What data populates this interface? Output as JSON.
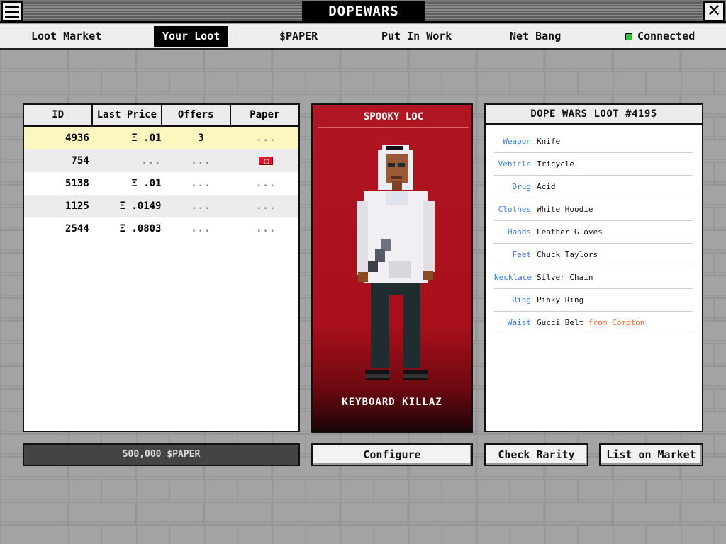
{
  "app": {
    "title": "DOPEWARS"
  },
  "nav": {
    "items": [
      {
        "label": "Loot Market"
      },
      {
        "label": "Your Loot"
      },
      {
        "label": "$PAPER"
      },
      {
        "label": "Put In Work"
      },
      {
        "label": "Net Bang"
      }
    ],
    "active": "Your Loot",
    "status_label": "Connected",
    "status_color": "#2bbf3a"
  },
  "table": {
    "columns": [
      "ID",
      "Last Price",
      "Offers",
      "Paper"
    ],
    "rows": [
      {
        "id": "4936",
        "price": "Ξ .01",
        "offers": "3",
        "paper": "..."
      },
      {
        "id": "754",
        "price": "...",
        "offers": "...",
        "paper": "paper-icon"
      },
      {
        "id": "5138",
        "price": "Ξ .01",
        "offers": "...",
        "paper": "..."
      },
      {
        "id": "1125",
        "price": "Ξ .0149",
        "offers": "...",
        "paper": "..."
      },
      {
        "id": "2544",
        "price": "Ξ .0803",
        "offers": "...",
        "paper": "..."
      }
    ]
  },
  "paper_balance": "500,000 $PAPER",
  "card": {
    "title": "SPOOKY LOC",
    "caption": "KEYBOARD KILLAZ",
    "background_color": "#b01622"
  },
  "details": {
    "title": "DOPE WARS LOOT #4195",
    "attributes": [
      {
        "key": "Weapon",
        "value": "Knife",
        "suffix": ""
      },
      {
        "key": "Vehicle",
        "value": "Tricycle",
        "suffix": ""
      },
      {
        "key": "Drug",
        "value": "Acid",
        "suffix": ""
      },
      {
        "key": "Clothes",
        "value": "White Hoodie",
        "suffix": ""
      },
      {
        "key": "Hands",
        "value": "Leather Gloves",
        "suffix": ""
      },
      {
        "key": "Feet",
        "value": "Chuck Taylors",
        "suffix": ""
      },
      {
        "key": "Necklace",
        "value": "Silver Chain",
        "suffix": ""
      },
      {
        "key": "Ring",
        "value": "Pinky Ring",
        "suffix": ""
      },
      {
        "key": "Waist",
        "value": "Gucci Belt",
        "suffix": "from Compton"
      }
    ]
  },
  "buttons": {
    "configure": "Configure",
    "check_rarity": "Check Rarity",
    "list_on_market": "List on Market"
  }
}
